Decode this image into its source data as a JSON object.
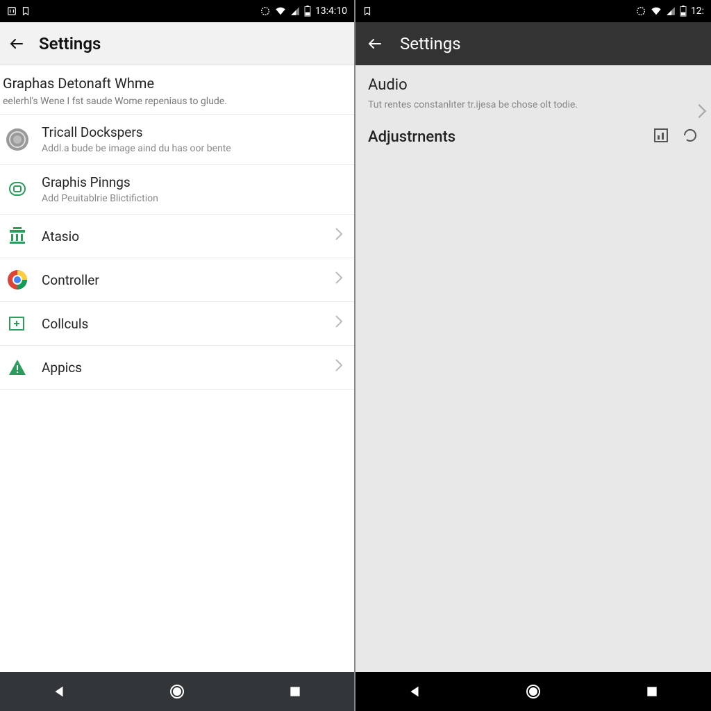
{
  "left": {
    "status_time": "13:4:10",
    "appbar_title": "Settings",
    "section": {
      "title": "Graphas Detonaft Whme",
      "sub": "eelerhl's Wene I fst saude Wome repeniaus to glude."
    },
    "rows": [
      {
        "title": "Tricall Dockspers",
        "sub": "Addl.a bude be image aind du has oor bente",
        "icon": "coin"
      },
      {
        "title": "Graphis Pinngs",
        "sub": "Add Peuitablrie Blictifiction",
        "icon": "shield"
      },
      {
        "title": "Atasio",
        "icon": "bank",
        "chevron": true
      },
      {
        "title": "Controller",
        "icon": "chrome",
        "chevron": true
      },
      {
        "title": "Collculs",
        "icon": "plus",
        "chevron": true
      },
      {
        "title": "Appics",
        "icon": "warn",
        "chevron": true
      }
    ]
  },
  "right": {
    "status_time": "12:",
    "appbar_title": "Settings",
    "audio": {
      "title": "Audio",
      "sub": "Tut rentes constanlıter tr.ijesa be chose olt todie."
    },
    "adjustments_label": "Adjustrnents"
  }
}
